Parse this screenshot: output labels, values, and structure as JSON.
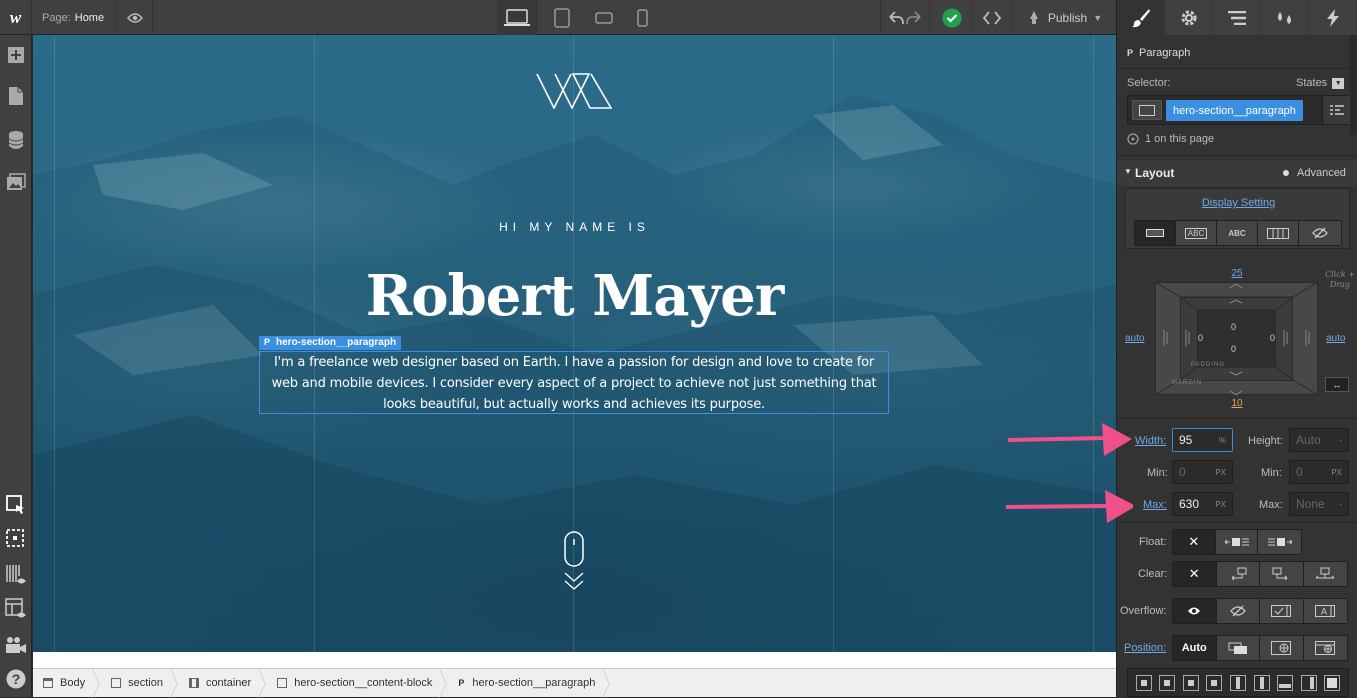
{
  "topbar": {
    "page_label": "Page:",
    "page_name": "Home",
    "publish_label": "Publish"
  },
  "canvas": {
    "eyebrow": "HI MY NAME IS",
    "name": "Robert Mayer",
    "selected_tag_letter": "P",
    "selected_tag_class": "hero-section__paragraph",
    "paragraph": "I'm a freelance web designer based on Earth. I have a passion for design and love to create for web and mobile devices. I consider every aspect of a project to achieve not just something that looks beautiful, but actually works and achieves its purpose."
  },
  "breadcrumbs": [
    {
      "label": "Body"
    },
    {
      "label": "section"
    },
    {
      "label": "container"
    },
    {
      "label": "hero-section__content-block"
    },
    {
      "label": "hero-section__paragraph",
      "prefix": "P"
    }
  ],
  "panel": {
    "element_type_letter": "P",
    "element_type": "Paragraph",
    "selector_label": "Selector:",
    "states_label": "States",
    "selector_tag": "hero-section__paragraph",
    "on_page": "1 on this page",
    "layout_title": "Layout",
    "advanced_label": "Advanced",
    "display_setting": "Display Setting",
    "display_abc1": "ABC",
    "display_abc2": "ABC",
    "box": {
      "margin_top": "25",
      "margin_bottom": "10",
      "margin_left": "auto",
      "margin_right": "auto",
      "padding_top": "0",
      "padding_bottom": "0",
      "padding_left": "0",
      "padding_right": "0",
      "padding_label": "PADDING",
      "margin_label": "MARGIN",
      "hint": "Click + Drag"
    },
    "width_label": "Width:",
    "width_value": "95",
    "width_unit": "%",
    "height_label": "Height:",
    "height_placeholder": "Auto",
    "height_unit": "-",
    "min_label": "Min:",
    "min_w_placeholder": "0",
    "min_w_unit": "PX",
    "min_h_placeholder": "0",
    "min_h_unit": "PX",
    "max_label": "Max:",
    "max_w_value": "630",
    "max_w_unit": "PX",
    "max_h_placeholder": "None",
    "max_h_unit": "-",
    "float_label": "Float:",
    "clear_label": "Clear:",
    "overflow_label": "Overflow:",
    "position_label": "Position:",
    "position_auto": "Auto"
  },
  "colors": {
    "accent_blue": "#3b8fe0",
    "arrow_pink": "#f0508a",
    "check_green": "#24a148"
  }
}
